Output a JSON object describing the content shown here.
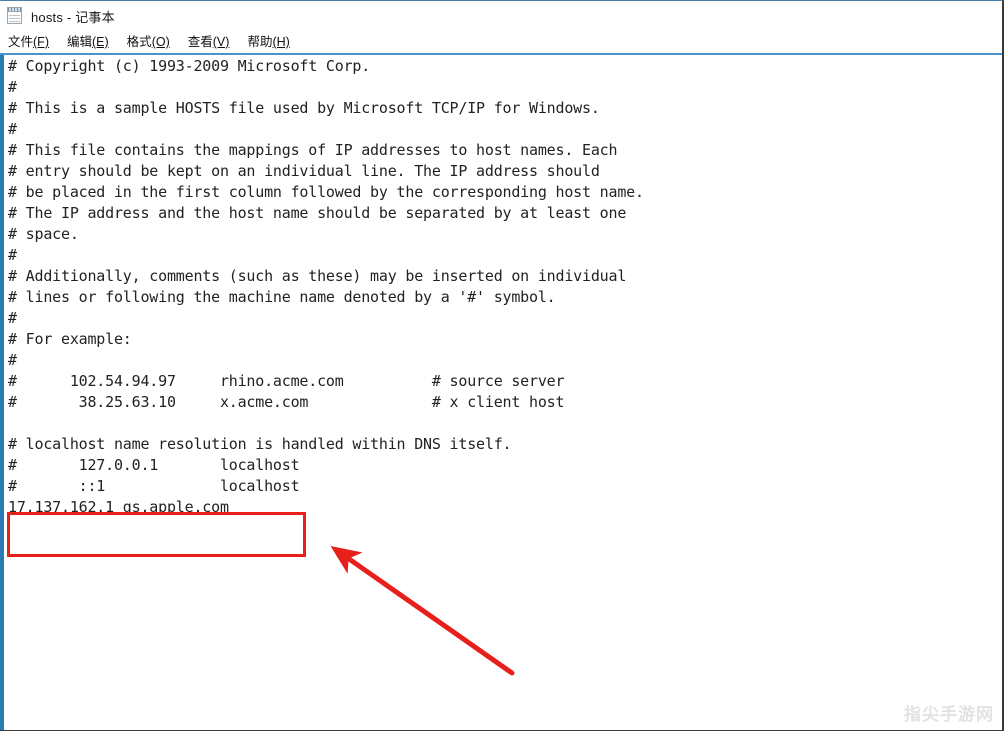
{
  "window": {
    "title": "hosts - 记事本",
    "icon": "notepad-icon"
  },
  "menu": {
    "items": [
      {
        "label": "文件",
        "accel": "(F)"
      },
      {
        "label": "编辑",
        "accel": "(E)"
      },
      {
        "label": "格式",
        "accel": "(O)"
      },
      {
        "label": "查看",
        "accel": "(V)"
      },
      {
        "label": "帮助",
        "accel": "(H)"
      }
    ]
  },
  "editor": {
    "lines": [
      "# Copyright (c) 1993-2009 Microsoft Corp.",
      "#",
      "# This is a sample HOSTS file used by Microsoft TCP/IP for Windows.",
      "#",
      "# This file contains the mappings of IP addresses to host names. Each",
      "# entry should be kept on an individual line. The IP address should",
      "# be placed in the first column followed by the corresponding host name.",
      "# The IP address and the host name should be separated by at least one",
      "# space.",
      "#",
      "# Additionally, comments (such as these) may be inserted on individual",
      "# lines or following the machine name denoted by a '#' symbol.",
      "#",
      "# For example:",
      "#",
      "#      102.54.94.97     rhino.acme.com          # source server",
      "#       38.25.63.10     x.acme.com              # x client host",
      "",
      "# localhost name resolution is handled within DNS itself.",
      "#       127.0.0.1       localhost",
      "#       ::1             localhost",
      "17.137.162.1 gs.apple.com"
    ],
    "highlighted_line": "17.137.162.1 gs.apple.com"
  },
  "annotations": {
    "highlight_color": "#e8201c",
    "arrow_color": "#e8201c",
    "arrow_label": "points-to-highlighted-host-entry"
  },
  "watermark": {
    "text": "指尖手游网",
    "color": "#e2e2e2"
  },
  "colors": {
    "text_area_left_border": "#2b7ab5",
    "menu_separator": "#4a93cc",
    "window_border": "#3a3a3a"
  }
}
